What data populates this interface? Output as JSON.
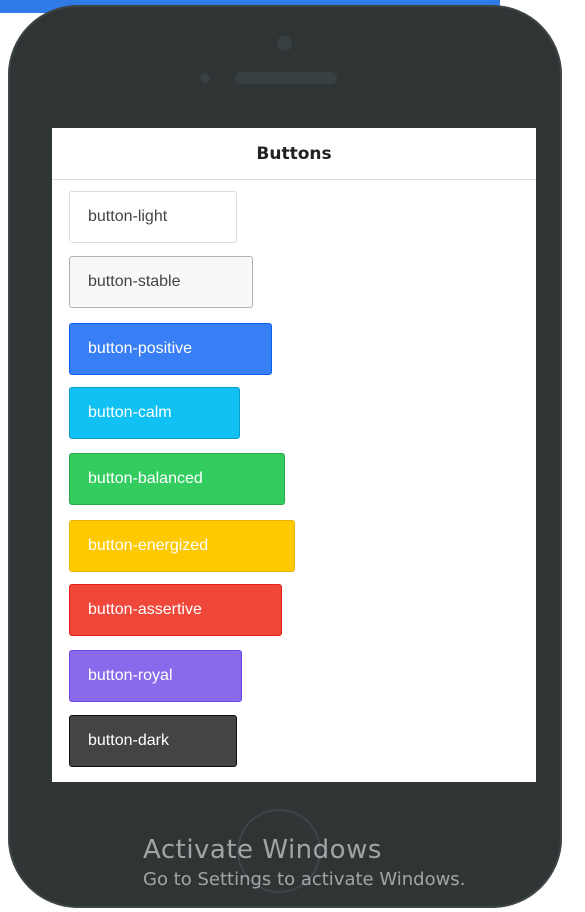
{
  "colors": {
    "phone_body": "#2f3435",
    "screen_bg": "#ffffff",
    "light": "#ffffff",
    "stable": "#f8f8f8",
    "positive": "#387ef5",
    "calm": "#11c1f3",
    "balanced": "#33cd5f",
    "energized": "#ffc900",
    "assertive": "#ef473a",
    "royal": "#886aea",
    "dark": "#444444"
  },
  "header": {
    "title": "Buttons"
  },
  "buttons": {
    "light": "button-light",
    "stable": "button-stable",
    "positive": "button-positive",
    "calm": "button-calm",
    "balanced": "button-balanced",
    "energized": "button-energized",
    "assertive": "button-assertive",
    "royal": "button-royal",
    "dark": "button-dark"
  },
  "activation": {
    "title": "Activate Windows",
    "subtitle": "Go to Settings to activate Windows."
  }
}
